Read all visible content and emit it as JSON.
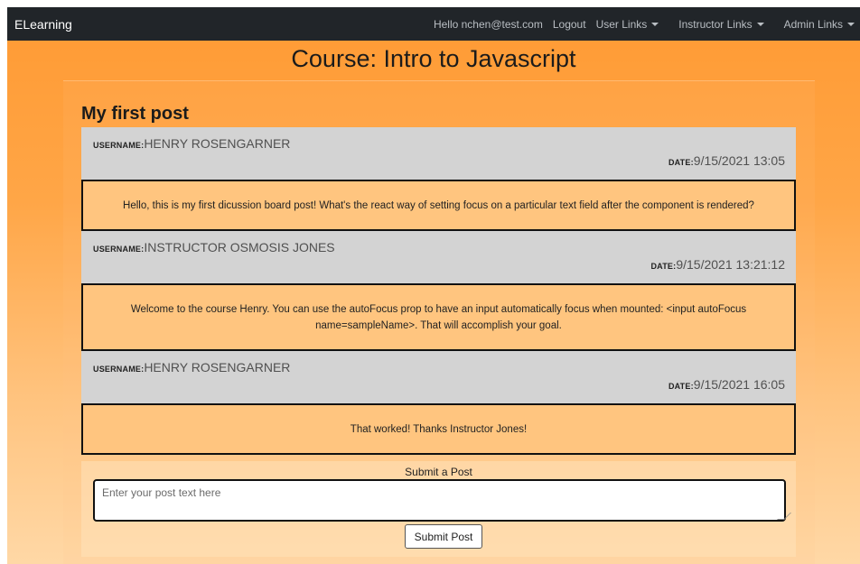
{
  "navbar": {
    "brand": "ELearning",
    "greeting": "Hello nchen@test.com",
    "logout": "Logout",
    "user_links": "User Links",
    "instructor_links": "Instructor Links",
    "admin_links": "Admin Links"
  },
  "course_title": "Course: Intro to Javascript",
  "post_title": "My first post",
  "labels": {
    "username": "USERNAME:",
    "date": "DATE:"
  },
  "posts": [
    {
      "username": "HENRY ROSENGARNER",
      "date": "9/15/2021 13:05",
      "message": "Hello, this is my first dicussion board post! What's the react way of setting focus on a particular text field after the component is rendered?"
    },
    {
      "username": "INSTRUCTOR OSMOSIS JONES",
      "date": "9/15/2021 13:21:12",
      "message": "Welcome to the course Henry. You can use the autoFocus prop to have an input automatically focus when mounted: <input autoFocus name=sampleName>. That will accomplish your goal."
    },
    {
      "username": "HENRY ROSENGARNER",
      "date": "9/15/2021 16:05",
      "message": "That worked! Thanks Instructor Jones!"
    }
  ],
  "submit": {
    "label": "Submit a Post",
    "placeholder": "Enter your post text here",
    "button": "Submit Post"
  }
}
